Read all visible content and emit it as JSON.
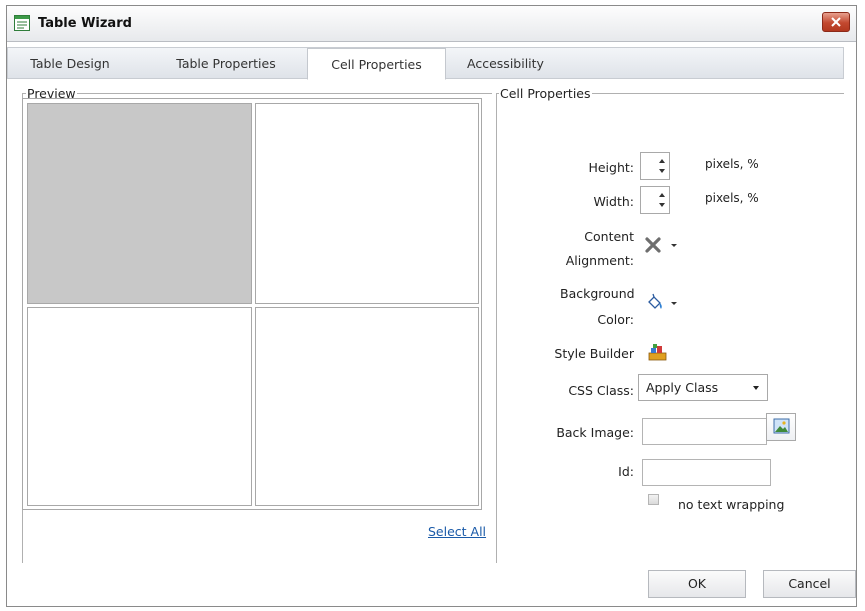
{
  "window": {
    "title": "Table Wizard"
  },
  "tabs": [
    {
      "label": "Table Design",
      "active": false
    },
    {
      "label": "Table Properties",
      "active": false
    },
    {
      "label": "Cell Properties",
      "active": true
    },
    {
      "label": "Accessibility",
      "active": false
    }
  ],
  "preview": {
    "legend": "Preview",
    "select_all": "Select All",
    "grid": {
      "rows": 2,
      "cols": 2,
      "selected_cell": "row 1, col 1"
    }
  },
  "cell_properties": {
    "legend": "Cell Properties",
    "height": {
      "label": "Height:",
      "value": "",
      "unit": "pixels, %"
    },
    "width": {
      "label": "Width:",
      "value": "",
      "unit": "pixels, %"
    },
    "content_alignment": {
      "label_line1": "Content",
      "label_line2": "Alignment:",
      "icon": "no-alignment-x-icon"
    },
    "background_color": {
      "label_line1": "Background",
      "label_line2": "Color:",
      "icon": "paint-bucket-icon"
    },
    "style_builder": {
      "label": "Style Builder",
      "icon": "style-builder-icon"
    },
    "css_class": {
      "label": "CSS Class:",
      "value": "Apply Class"
    },
    "back_image": {
      "label": "Back Image:",
      "value": "",
      "icon": "image-picker-icon"
    },
    "id": {
      "label": "Id:",
      "value": ""
    },
    "no_wrap": {
      "label": "no text wrapping",
      "checked": false
    }
  },
  "footer": {
    "ok": "OK",
    "cancel": "Cancel"
  },
  "colors": {
    "selected_cell": "#c8c8c8",
    "link": "#1a5aa8",
    "close_button": "#c2482f"
  }
}
